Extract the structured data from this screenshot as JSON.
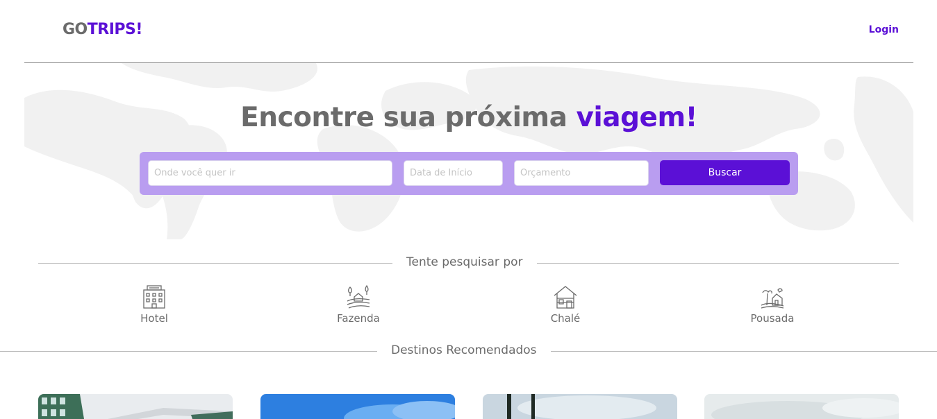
{
  "header": {
    "logo_part1": "GO",
    "logo_part2": "TRIPS!",
    "login_label": "Login"
  },
  "hero": {
    "title_main": "Encontre sua próxima",
    "title_accent": "viagem!"
  },
  "search": {
    "destination_placeholder": "Onde você quer ir",
    "start_date_placeholder": "Data de Início",
    "budget_placeholder": "Orçamento",
    "button_label": "Buscar"
  },
  "categories_section": {
    "title": "Tente pesquisar por",
    "items": [
      {
        "label": "Hotel",
        "icon": "hotel-icon"
      },
      {
        "label": "Fazenda",
        "icon": "farm-icon"
      },
      {
        "label": "Chalé",
        "icon": "chalet-icon"
      },
      {
        "label": "Pousada",
        "icon": "inn-icon"
      }
    ]
  },
  "destinations_section": {
    "title": "Destinos Recomendados"
  },
  "colors": {
    "accent": "#5b10d6",
    "search_bar": "#b99df0",
    "text": "#6b6b6b"
  }
}
